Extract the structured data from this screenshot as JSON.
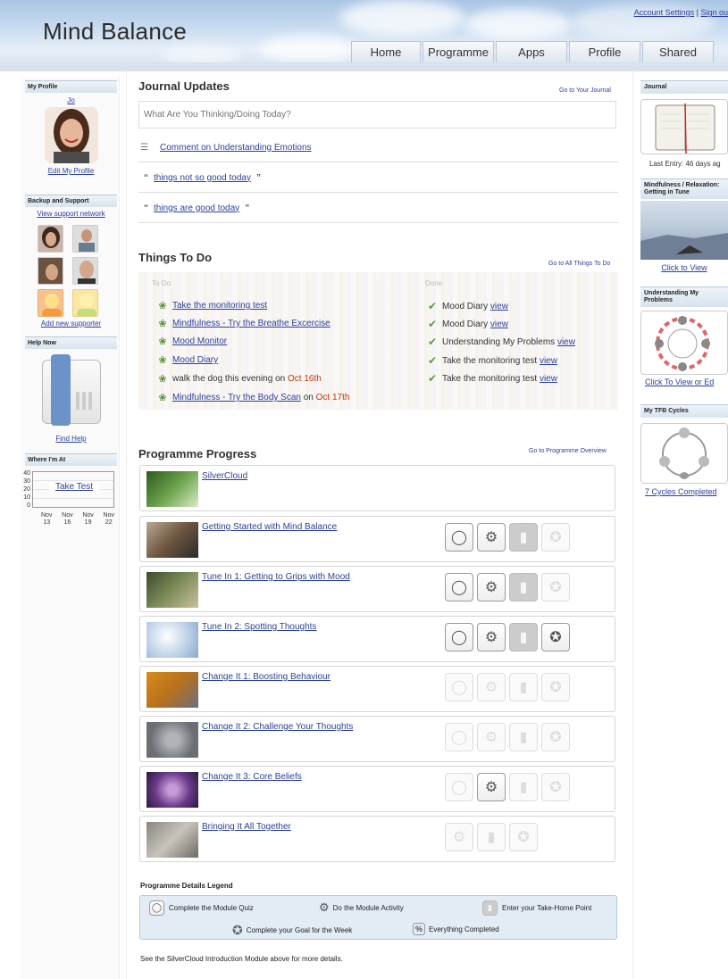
{
  "header": {
    "brand": "Mind Balance",
    "account_settings": "Account Settings",
    "separator": " | ",
    "sign_out": "Sign ou",
    "tabs": [
      "Home",
      "Programme",
      "Apps",
      "Profile",
      "Shared"
    ]
  },
  "left": {
    "my_profile": {
      "title": "My Profile",
      "name": "Jo",
      "edit_link": "Edit My Profile"
    },
    "backup": {
      "title": "Backup and Support",
      "view_link": "View support network",
      "add_link": "Add new supporter"
    },
    "help": {
      "title": "Help Now",
      "find_link": "Find Help"
    },
    "where": {
      "title": "Where I'm At",
      "button": "Take Test",
      "y_ticks": [
        "40",
        "30",
        "20",
        "10",
        "0"
      ],
      "x_months": [
        "Nov",
        "Nov",
        "Nov",
        "Nov"
      ],
      "x_days": [
        "13",
        "16",
        "19",
        "22"
      ]
    }
  },
  "journal": {
    "title": "Journal Updates",
    "go_link": "Go to Your Journal",
    "placeholder": "What Are You Thinking/Doing Today?",
    "entries": [
      {
        "text": "Comment on Understanding Emotions",
        "icon": "comment-icon"
      },
      {
        "text": "things not so good today",
        "open": "“",
        "close": "”"
      },
      {
        "text": "things are good today",
        "open": "“",
        "close": "”"
      }
    ]
  },
  "todo": {
    "title": "Things To Do",
    "go_link": "Go to All Things To Do",
    "todo_label": "To Do",
    "done_label": "Done",
    "items": [
      {
        "text": "Take the monitoring test",
        "link": true,
        "suffix": "",
        "date": ""
      },
      {
        "text": "Mindfulness - Try the Breathe Excercise",
        "link": true,
        "suffix": "",
        "date": ""
      },
      {
        "text": "Mood Monitor",
        "link": true,
        "suffix": "",
        "date": ""
      },
      {
        "text": "Mood Diary",
        "link": true,
        "suffix": "",
        "date": ""
      },
      {
        "text": "walk the dog this evening",
        "link": false,
        "suffix": " on ",
        "date": "Oct 16th"
      },
      {
        "text": "Mindfulness - Try the Body Scan",
        "link": true,
        "suffix": " on ",
        "date": "Oct 17th"
      }
    ],
    "done": [
      {
        "text": "Mood Diary",
        "view": "view"
      },
      {
        "text": "Mood Diary",
        "view": "view"
      },
      {
        "text": "Understanding My Problems",
        "view": "view"
      },
      {
        "text": "Take the monitoring test",
        "view": "view"
      },
      {
        "text": "Take the monitoring test",
        "view": "view"
      }
    ]
  },
  "progress": {
    "title": "Programme Progress",
    "go_link": "Go to Programme Overview",
    "modules": [
      {
        "title": "SilverCloud",
        "icons": []
      },
      {
        "title": "Getting Started with Mind Balance",
        "icons": [
          "on",
          "on",
          "mid",
          "dim"
        ]
      },
      {
        "title": "Tune In 1: Getting to Grips with Mood",
        "icons": [
          "on",
          "on",
          "mid",
          "dim"
        ]
      },
      {
        "title": "Tune In 2: Spotting Thoughts",
        "icons": [
          "on",
          "on",
          "mid",
          "on"
        ]
      },
      {
        "title": "Change It 1: Boosting Behaviour",
        "icons": [
          "dim",
          "dim",
          "dim",
          "dim"
        ]
      },
      {
        "title": "Change It 2: Challenge Your Thoughts",
        "icons": [
          "dim",
          "dim",
          "dim",
          "dim"
        ]
      },
      {
        "title": "Change It 3: Core Beliefs",
        "icons": [
          "dim",
          "on",
          "dim",
          "dim"
        ]
      },
      {
        "title": "Bringing It All Together",
        "icons": [
          "dim",
          "dim",
          "dim"
        ]
      }
    ]
  },
  "legend": {
    "title": "Programme Details Legend",
    "items": [
      "Complete the Module Quiz",
      "Do the Module Activity",
      "Enter your Take-Home Point",
      "Complete your Goal for the Week",
      "Everything Completed"
    ],
    "note": "See the SilverCloud Introduction Module above for more details."
  },
  "right": {
    "journal": {
      "title": "Journal",
      "last_entry": "Last Entry: 46 days ag"
    },
    "mindfulness": {
      "title": "Mindfulness / Relaxation: Getting in Tune",
      "link": "Click to View"
    },
    "understanding": {
      "title": "Understanding My Problems",
      "link": "Click To View or Ed"
    },
    "tfb": {
      "title": "My TFB Cycles",
      "link": "7 Cycles Completed"
    }
  }
}
